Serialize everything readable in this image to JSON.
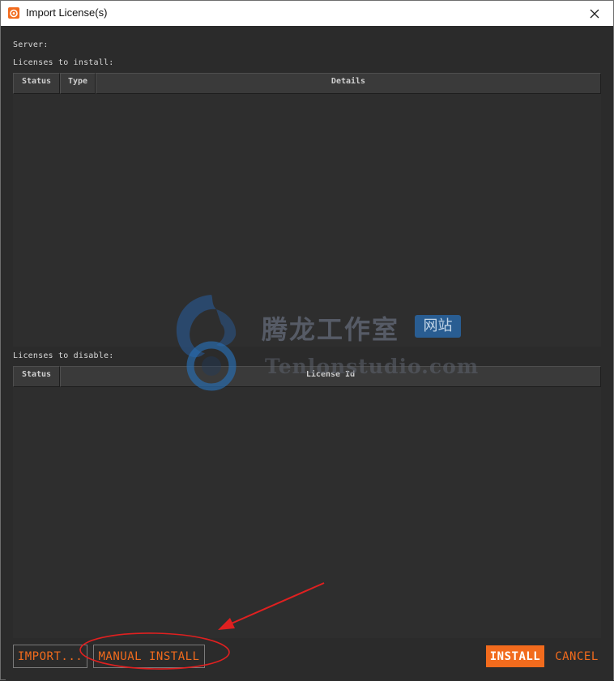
{
  "window": {
    "title": "Import License(s)",
    "accent_color": "#f26b1d"
  },
  "labels": {
    "server": "Server:",
    "licenses_to_install": "Licenses to install:",
    "licenses_to_disable": "Licenses to disable:"
  },
  "install_table": {
    "columns": [
      "Status",
      "Type",
      "Details"
    ],
    "rows": []
  },
  "disable_table": {
    "columns": [
      "Status",
      "License Id"
    ],
    "rows": []
  },
  "buttons": {
    "import": "IMPORT...",
    "manual_install": "MANUAL INSTALL",
    "install": "INSTALL",
    "cancel": "CANCEL"
  },
  "watermark": {
    "cn_text": "腾龙工作室",
    "badge_text": "网站",
    "en_text": "Tenlonstudio.com"
  },
  "annotation": {
    "color": "#e02020"
  },
  "icons": {
    "app": "houdini-app-icon",
    "close": "close-icon"
  }
}
